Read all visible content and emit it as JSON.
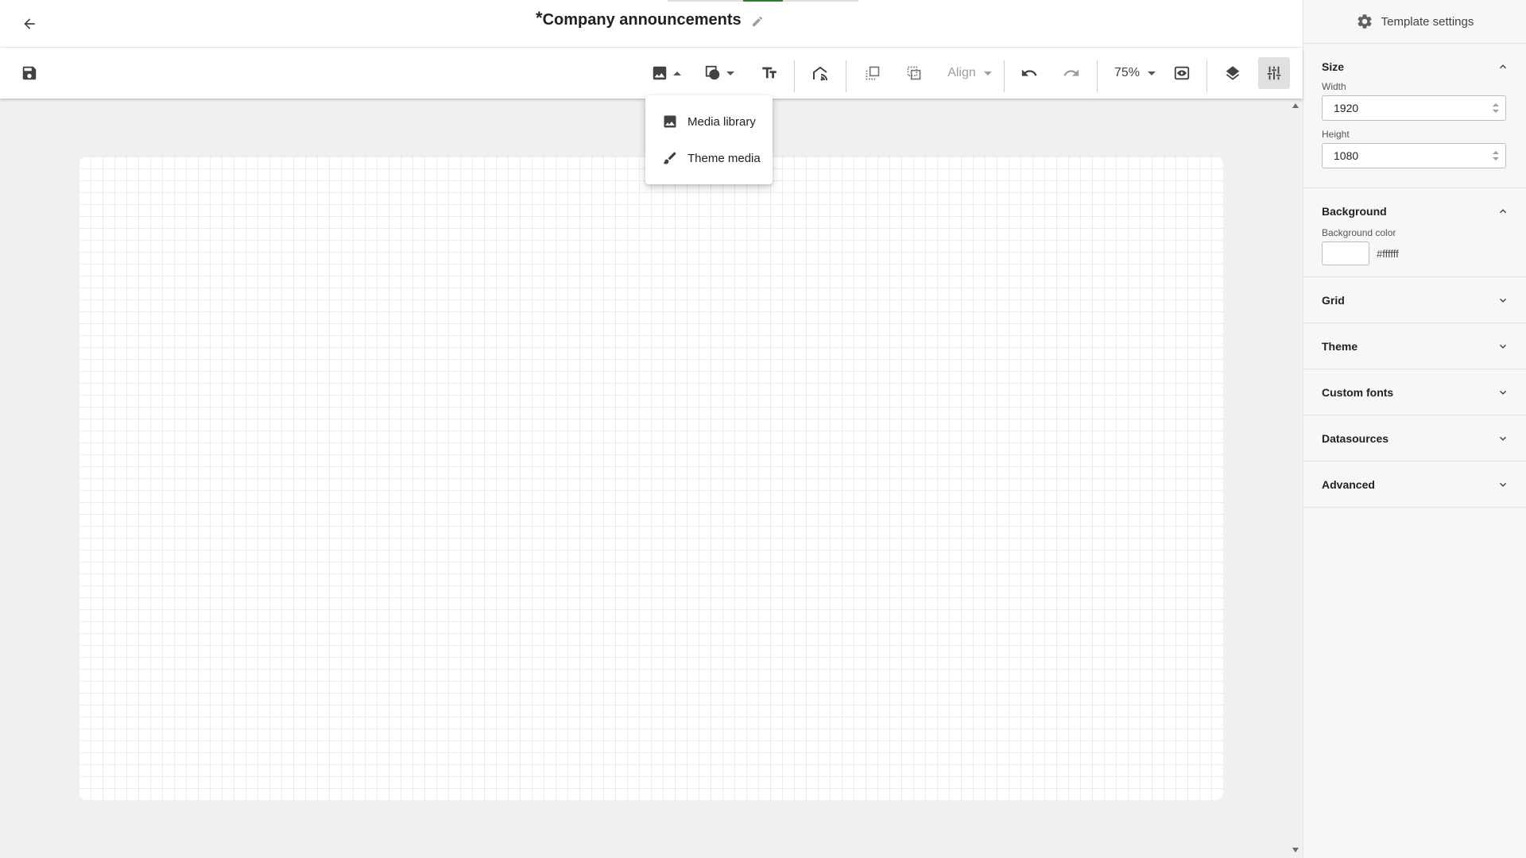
{
  "header": {
    "unsaved_marker": "*",
    "title": "Company announcements"
  },
  "toolbar": {
    "image_icon": "image-icon",
    "shapes_icon": "shapes-icon",
    "text_icon": "text-format-icon",
    "widget_icon": "widget-icon",
    "align_label": "Align",
    "zoom_label": "75%"
  },
  "media_menu": {
    "items": [
      {
        "label": "Media library",
        "icon": "image-icon"
      },
      {
        "label": "Theme media",
        "icon": "brush-icon"
      }
    ]
  },
  "panel": {
    "title": "Template settings",
    "size": {
      "title": "Size",
      "width_label": "Width",
      "width_value": "1920",
      "height_label": "Height",
      "height_value": "1080"
    },
    "background": {
      "title": "Background",
      "color_label": "Background color",
      "color_value": "#ffffff"
    },
    "collapsed_sections": [
      "Grid",
      "Theme",
      "Custom fonts",
      "Datasources",
      "Advanced"
    ]
  },
  "colors": {
    "accent": "#2e7d32",
    "canvas": "#ffffff",
    "workspace": "#f0f0f0"
  }
}
